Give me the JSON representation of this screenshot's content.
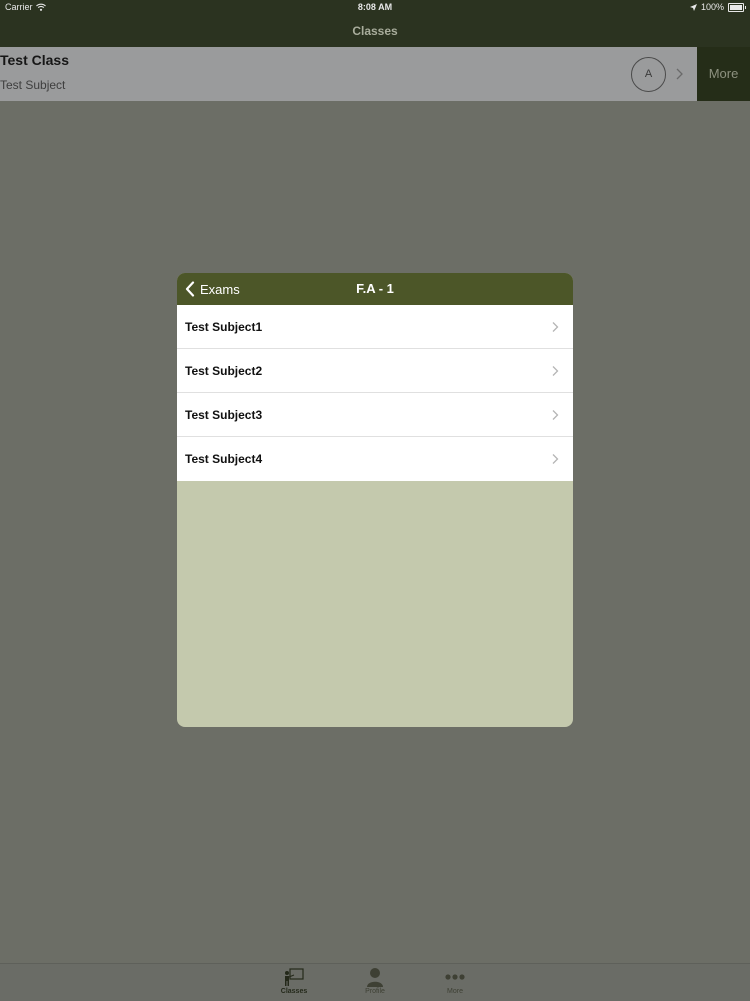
{
  "status_bar": {
    "carrier": "Carrier",
    "time": "8:08 AM",
    "battery": "100%"
  },
  "nav": {
    "title": "Classes"
  },
  "class_row": {
    "title": "Test Class",
    "subtitle": "Test Subject",
    "avatar_letter": "A",
    "more_label": "More"
  },
  "modal": {
    "back_label": "Exams",
    "title": "F.A - 1",
    "subjects": [
      {
        "label": "Test Subject1"
      },
      {
        "label": "Test Subject2"
      },
      {
        "label": "Test Subject3"
      },
      {
        "label": "Test Subject4"
      }
    ]
  },
  "tab_bar": {
    "tabs": [
      {
        "label": "Classes",
        "icon": "classes-teacher-icon",
        "active": true
      },
      {
        "label": "Profile",
        "icon": "profile-icon",
        "active": false
      },
      {
        "label": "More",
        "icon": "more-dots-icon",
        "active": false
      }
    ]
  },
  "colors": {
    "header": "#2b3320",
    "modal_header": "#4c5628",
    "overlay": "#6c6e66",
    "modal_body": "#c4c9ad"
  }
}
